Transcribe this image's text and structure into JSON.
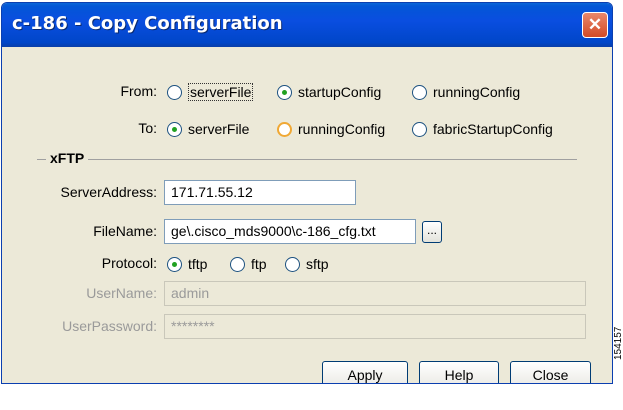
{
  "window": {
    "title": "c-186 - Copy Configuration",
    "close_glyph": "✕"
  },
  "from": {
    "label": "From:",
    "options": [
      "serverFile",
      "startupConfig",
      "runningConfig"
    ],
    "selected": "startupConfig"
  },
  "to": {
    "label": "To:",
    "options": [
      "serverFile",
      "runningConfig",
      "fabricStartupConfig"
    ],
    "selected": "serverFile"
  },
  "xftp": {
    "section_label": "xFTP",
    "server_address": {
      "label": "ServerAddress:",
      "value": "171.71.55.12"
    },
    "file_name": {
      "label": "FileName:",
      "value": "ge\\.cisco_mds9000\\c-186_cfg.txt",
      "browse_label": "..."
    },
    "protocol": {
      "label": "Protocol:",
      "options": [
        "tftp",
        "ftp",
        "sftp"
      ],
      "selected": "tftp"
    },
    "user_name": {
      "label": "UserName:",
      "value": "admin"
    },
    "user_password": {
      "label": "UserPassword:",
      "value": "********"
    }
  },
  "buttons": {
    "apply": "Apply",
    "help": "Help",
    "close": "Close"
  },
  "figure_code": "154157"
}
